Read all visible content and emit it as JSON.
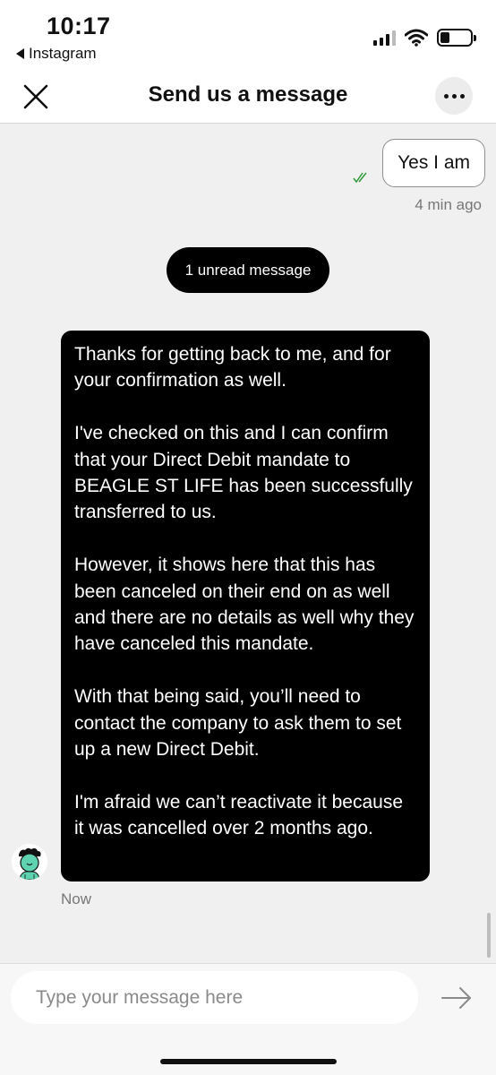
{
  "status_bar": {
    "time": "10:17",
    "back_app": "Instagram",
    "icons": [
      "signal-icon",
      "wifi-icon",
      "battery-icon"
    ]
  },
  "header": {
    "title": "Send us a message",
    "close_icon": "close-icon",
    "more_icon": "more-icon"
  },
  "messages": {
    "outgoing": {
      "text": "Yes I am",
      "time": "4 min ago",
      "status_icon": "read-check-icon"
    },
    "unread_label": "1 unread message",
    "incoming": {
      "paragraphs": [
        "Thanks for getting back to me, and for your confirmation as well.",
        "I've checked on this and I can confirm that your Direct Debit mandate to BEAGLE ST LIFE has been successfully transferred to us.",
        "However, it shows here that this has been canceled on their end on as well and there are no details as well why they have canceled this mandate.",
        "With that being said, you’ll need to contact the company to ask them to set up a new Direct Debit.",
        "I'm afraid we can’t reactivate it because it was cancelled over 2 months ago."
      ],
      "time": "Now",
      "avatar_icon": "agent-avatar-icon"
    }
  },
  "composer": {
    "placeholder": "Type your message here",
    "value": "",
    "send_icon": "send-arrow-icon"
  },
  "colors": {
    "chat_background": "#f0f0f0",
    "incoming_bubble": "#000000",
    "read_check": "#2e9b3a",
    "avatar_accent": "#5fd3b0"
  }
}
